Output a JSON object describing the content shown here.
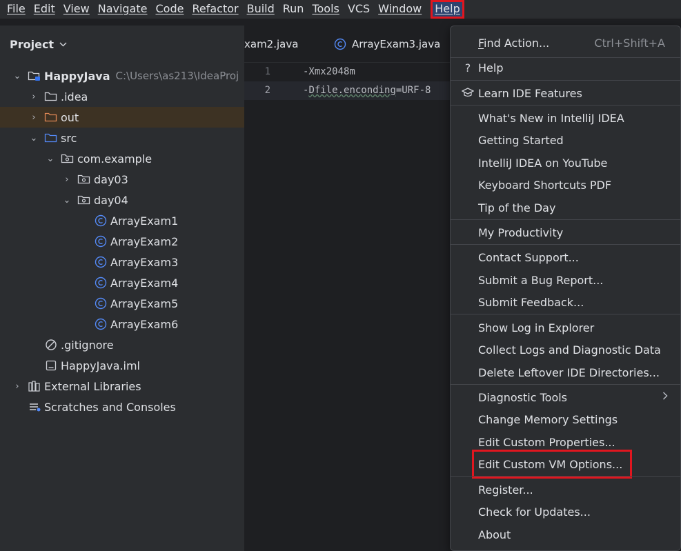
{
  "menubar": {
    "items": [
      {
        "label": "File"
      },
      {
        "label": "Edit"
      },
      {
        "label": "View"
      },
      {
        "label": "Navigate"
      },
      {
        "label": "Code"
      },
      {
        "label": "Refactor"
      },
      {
        "label": "Build"
      },
      {
        "label": "Run"
      },
      {
        "label": "Tools"
      },
      {
        "label": "VCS"
      },
      {
        "label": "Window"
      },
      {
        "label": "Help"
      }
    ]
  },
  "project": {
    "title": "Project",
    "tree": [
      {
        "label": "HappyJava",
        "path": "C:\\Users\\as213\\IdeaProj",
        "icon": "module-folder-icon"
      },
      {
        "label": ".idea",
        "icon": "folder-icon"
      },
      {
        "label": "out",
        "icon": "excluded-folder-icon"
      },
      {
        "label": "src",
        "icon": "source-folder-icon"
      },
      {
        "label": "com.example",
        "icon": "package-icon"
      },
      {
        "label": "day03",
        "icon": "package-icon"
      },
      {
        "label": "day04",
        "icon": "package-icon"
      },
      {
        "label": "ArrayExam1",
        "icon": "class-icon"
      },
      {
        "label": "ArrayExam2",
        "icon": "class-icon"
      },
      {
        "label": "ArrayExam3",
        "icon": "class-icon"
      },
      {
        "label": "ArrayExam4",
        "icon": "class-icon"
      },
      {
        "label": "ArrayExam5",
        "icon": "class-icon"
      },
      {
        "label": "ArrayExam6",
        "icon": "class-icon"
      },
      {
        "label": ".gitignore",
        "icon": "ignore-file-icon"
      },
      {
        "label": "HappyJava.iml",
        "icon": "iml-file-icon"
      },
      {
        "label": "External Libraries",
        "icon": "library-icon"
      },
      {
        "label": "Scratches and Consoles",
        "icon": "scratches-icon"
      }
    ]
  },
  "editor": {
    "tabs": [
      {
        "label": "xam2.java"
      },
      {
        "label": "ArrayExam3.java"
      }
    ],
    "lines": [
      {
        "num": "1",
        "code": "-Xmx2048m"
      },
      {
        "num": "2",
        "code_prefix": "-",
        "code_squig": "Dfile.enconding",
        "code_suffix": "=URF-8"
      }
    ]
  },
  "help_menu": {
    "items": [
      {
        "label": "Find Action...",
        "shortcut": "Ctrl+Shift+A"
      },
      {
        "label": "Help",
        "icon": "question-icon"
      },
      {
        "label": "Learn IDE Features",
        "icon": "graduation-cap-icon"
      },
      {
        "label": "What's New in IntelliJ IDEA"
      },
      {
        "label": "Getting Started"
      },
      {
        "label": "IntelliJ IDEA on YouTube"
      },
      {
        "label": "Keyboard Shortcuts PDF"
      },
      {
        "label": "Tip of the Day"
      },
      {
        "label": "My Productivity"
      },
      {
        "label": "Contact Support..."
      },
      {
        "label": "Submit a Bug Report..."
      },
      {
        "label": "Submit Feedback..."
      },
      {
        "label": "Show Log in Explorer"
      },
      {
        "label": "Collect Logs and Diagnostic Data"
      },
      {
        "label": "Delete Leftover IDE Directories..."
      },
      {
        "label": "Diagnostic Tools"
      },
      {
        "label": "Change Memory Settings"
      },
      {
        "label": "Edit Custom Properties..."
      },
      {
        "label": "Edit Custom VM Options..."
      },
      {
        "label": "Register..."
      },
      {
        "label": "Check for Updates..."
      },
      {
        "label": "About"
      }
    ]
  },
  "colors": {
    "highlight_box": "#e0161f",
    "background": "#1e1f22",
    "panel": "#2b2d30",
    "selected_row": "#3d3223",
    "class_icon": "#548af7"
  }
}
